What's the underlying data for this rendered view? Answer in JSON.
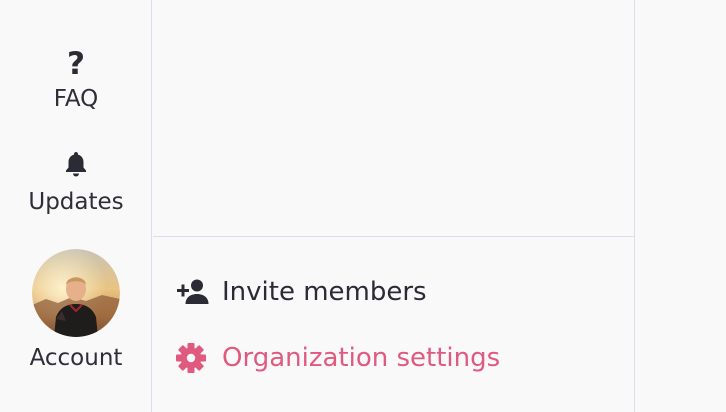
{
  "nav_rail": {
    "items": [
      {
        "label": "FAQ",
        "icon": "question-icon"
      },
      {
        "label": "Updates",
        "icon": "bell-icon"
      },
      {
        "label": "Account",
        "icon": "avatar"
      }
    ]
  },
  "menu": {
    "items": [
      {
        "label": "Invite members",
        "icon": "add-person-icon"
      },
      {
        "label": "Organization settings",
        "icon": "gear-icon"
      }
    ]
  },
  "colors": {
    "background": "#f9f9fa",
    "divider": "#dcdcec",
    "text": "#2b2b35",
    "accent": "#e05a7f"
  }
}
